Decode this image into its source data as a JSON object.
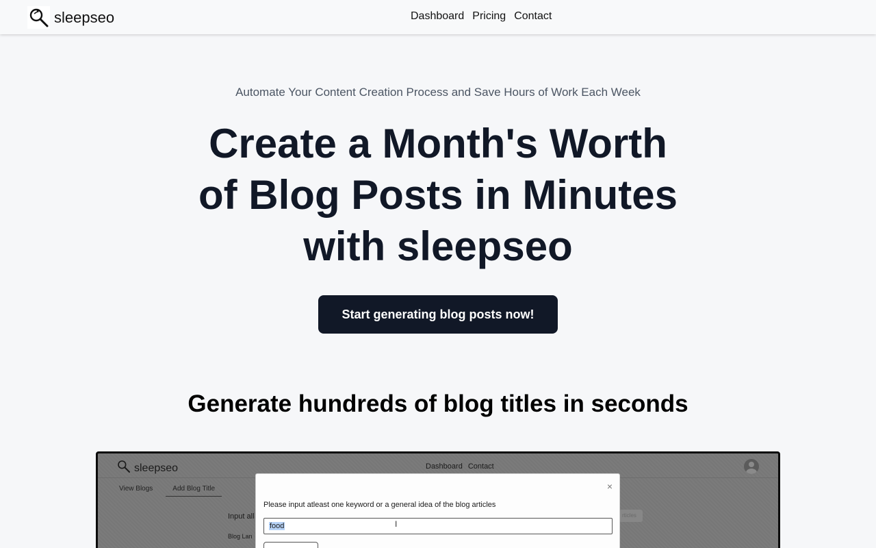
{
  "navbar": {
    "brand": "sleepseo",
    "links": [
      "Dashboard",
      "Pricing",
      "Contact"
    ]
  },
  "hero": {
    "tagline": "Automate Your Content Creation Process and Save Hours of Work Each Week",
    "title": "Create a Month's Worth of Blog Posts in Minutes with sleepseo",
    "cta_label": "Start generating blog posts now!"
  },
  "feature": {
    "title": "Generate hundreds of blog titles in seconds"
  },
  "demo": {
    "brand": "sleepseo",
    "nav_links": [
      "Dashboard",
      "Contact"
    ],
    "tabs": [
      "View Blogs",
      "Add Blog Title"
    ],
    "input_label": "Input all",
    "language_label": "Blog Lan",
    "right_button": "rticles",
    "modal": {
      "label": "Please input atleast one keyword or a general idea of the blog articles",
      "input_value": "food",
      "close": "×"
    }
  },
  "icons": {
    "logo": "magnifier-logo-icon",
    "close": "close-icon",
    "avatar": "user-avatar-icon",
    "cursor": "text-cursor-icon"
  }
}
